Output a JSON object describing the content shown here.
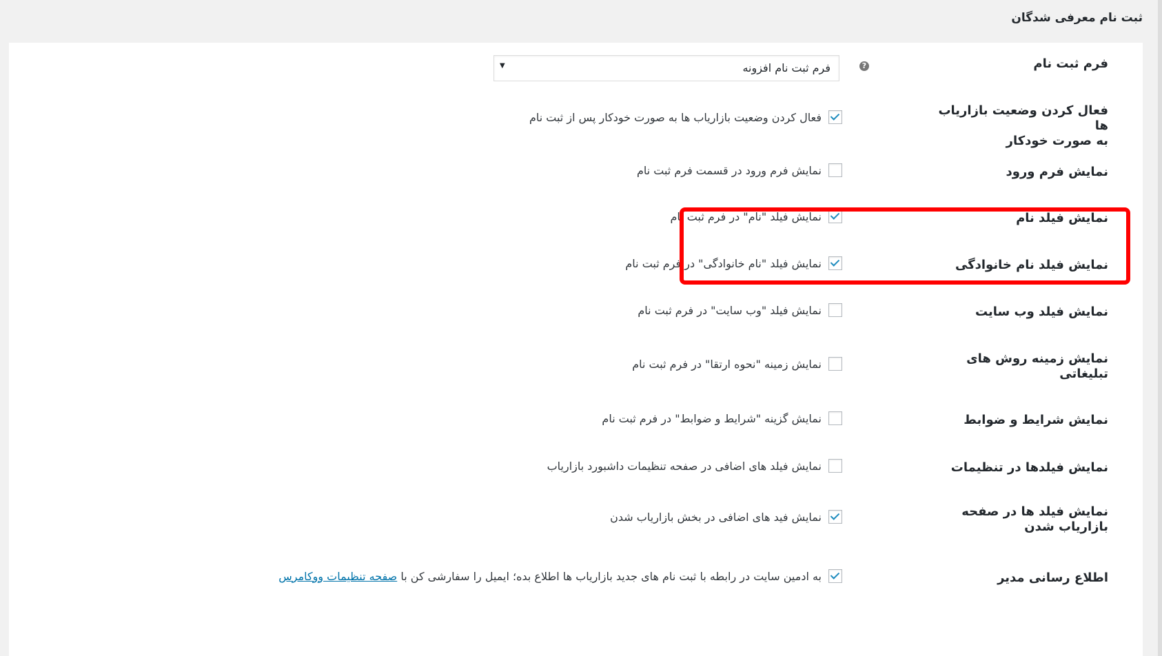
{
  "header": {
    "section_title": "ثبت نام معرفی شدگان"
  },
  "rows": {
    "registration_form": {
      "label": "فرم ثبت نام",
      "select_value": "فرم ثبت نام افزونه",
      "select_arrow": "▼",
      "help_glyph": "?"
    },
    "auto_activate": {
      "label_line1": "فعال کردن وضعیت بازاریاب ها",
      "label_line2": "به صورت خودکار",
      "checked": true,
      "text": "فعال کردن وضعیت بازاریاب ها به صورت خودکار پس از ثبت نام"
    },
    "show_login_form": {
      "label": "نمایش فرم ورود",
      "checked": false,
      "text": "نمایش فرم ورود در قسمت فرم ثبت نام"
    },
    "show_name_field": {
      "label": "نمایش فیلد نام",
      "checked": true,
      "text": "نمایش فیلد \"نام\" در فرم ثبت نام"
    },
    "show_lastname_field": {
      "label": "نمایش فیلد نام خانوادگی",
      "checked": true,
      "text": "نمایش فیلد \"نام خانوادگی\" در فرم ثبت نام"
    },
    "show_website_field": {
      "label": "نمایش فیلد وب سایت",
      "checked": false,
      "text": "نمایش فیلد \"وب سایت\" در فرم ثبت نام"
    },
    "show_promo_methods": {
      "label_line1": "نمایش زمینه روش های",
      "label_line2": "تبلیغاتی",
      "checked": false,
      "text": "نمایش زمینه \"نحوه ارتقا\" در فرم ثبت نام"
    },
    "show_terms": {
      "label": "نمایش شرایط و ضوابط",
      "checked": false,
      "text": "نمایش گزینه \"شرایط و ضوابط\" در فرم ثبت نام"
    },
    "show_fields_in_settings": {
      "label": "نمایش فیلدها در تنظیمات",
      "checked": false,
      "text": "نمایش فیلد های اضافی در صفحه تنظیمات داشبورد بازاریاب"
    },
    "show_fields_on_register": {
      "label_line1": "نمایش فیلد ها در صفحه",
      "label_line2": "بازاریاب شدن",
      "checked": true,
      "text": "نمایش فید های اضافی در بخش بازاریاب شدن"
    },
    "admin_notify": {
      "label": "اطلاع رسانی مدیر",
      "checked": true,
      "text": "به ادمین سایت در رابطه با ثبت نام های جدید بازاریاب ها اطلاع بده؛ ایمیل را سفارشی کن با",
      "link_text": "صفحه تنظیمات ووکامرس"
    }
  },
  "colors": {
    "highlight_border": "#ff0000",
    "checkmark": "#1e8cbe",
    "link": "#0073aa"
  }
}
